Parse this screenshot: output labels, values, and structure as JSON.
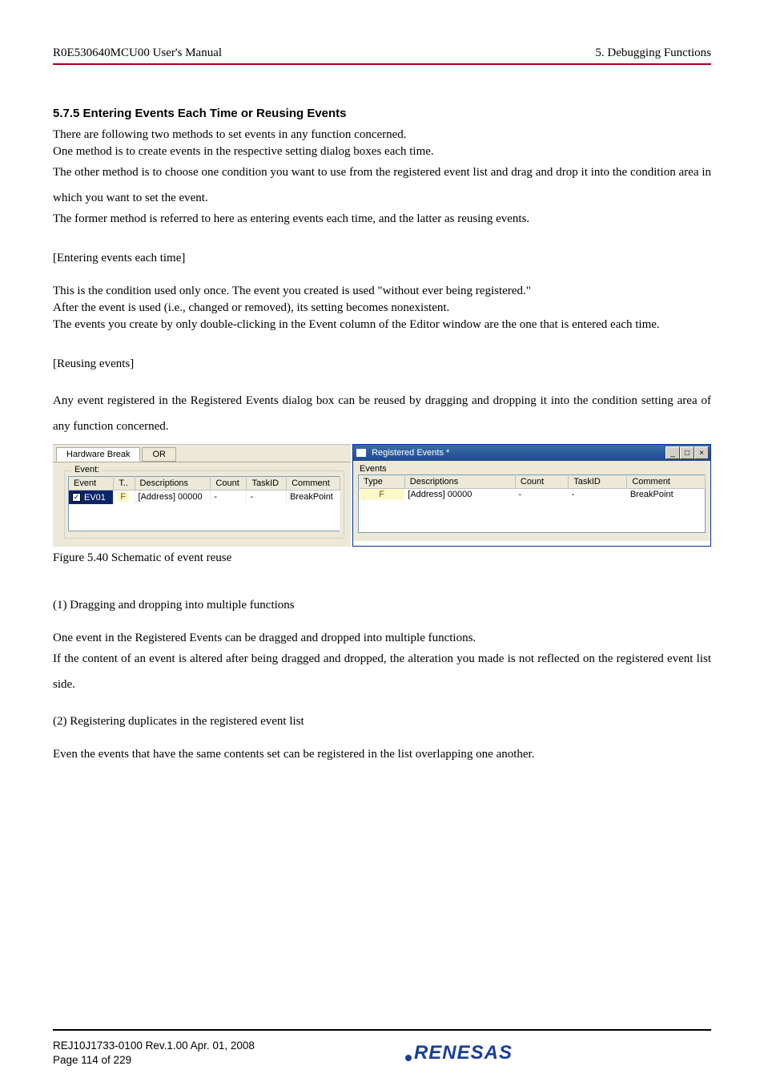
{
  "header": {
    "left": "R0E530640MCU00 User's Manual",
    "right": "5. Debugging Functions"
  },
  "section": {
    "num_title": "5.7.5    Entering Events Each Time or Reusing Events",
    "p1": "There are following two methods to set events in any function concerned.",
    "p2": "One method is to create events in the respective setting dialog boxes each time.",
    "p3": "The other method is to choose one condition you want to use from the registered event list and drag and drop it into the condition area in which you want to set the event.",
    "p4": "The former method is referred to here as entering events each time, and the latter as reusing events.",
    "h_enter": "[Entering events each time]",
    "p5": "This is the condition used only once. The event you created is used \"without ever being registered.\"",
    "p6": "After the event is used (i.e., changed or removed), its setting becomes nonexistent.",
    "p7": "The events you create by only double-clicking in the Event column of the Editor window are the one that is entered each time.",
    "h_reuse": "[Reusing events]",
    "p8": "Any event registered in the Registered Events dialog box can be reused by dragging and dropping it into the condition setting area of any function concerned."
  },
  "hw_break": {
    "tab1": "Hardware Break",
    "tab2": "OR",
    "legend": "Event:",
    "cols": {
      "event": "Event",
      "t": "T..",
      "desc": "Descriptions",
      "count": "Count",
      "taskid": "TaskID",
      "comment": "Comment"
    },
    "row": {
      "ev": "EV01",
      "t": "F",
      "desc": "[Address] 00000",
      "count": "-",
      "taskid": "-",
      "comment": "BreakPoint"
    }
  },
  "reg_events": {
    "title": "Registered Events *",
    "ev_label": "Events",
    "cols": {
      "type": "Type",
      "desc": "Descriptions",
      "count": "Count",
      "taskid": "TaskID",
      "comment": "Comment"
    },
    "row": {
      "type": "F",
      "desc": "[Address] 00000",
      "count": "-",
      "taskid": "-",
      "comment": "BreakPoint"
    },
    "win_min": "_",
    "win_max": "□",
    "win_close": "×"
  },
  "caption": "Figure 5.40 Schematic of event reuse",
  "sub1": {
    "h": "(1) Dragging and dropping into multiple functions",
    "p1": "One event in the Registered Events can be dragged and dropped into multiple functions.",
    "p2": "If the content of an event is altered after being dragged and dropped, the alteration you made is not reflected on the registered event list side."
  },
  "sub2": {
    "h": "(2) Registering duplicates in the registered event list",
    "p1": "Even the events that have the same contents set can be registered in the list overlapping one another."
  },
  "footer": {
    "line1": "REJ10J1733-0100  Rev.1.00   Apr. 01, 2008",
    "line2": "Page 114 of 229",
    "brand": "RENESAS"
  }
}
